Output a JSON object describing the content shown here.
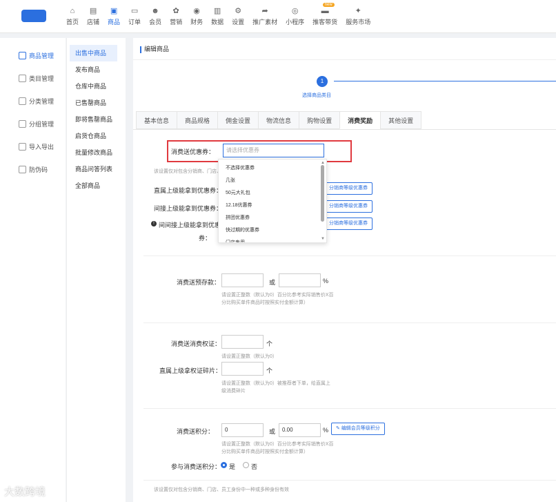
{
  "topnav": [
    {
      "label": "首页",
      "icon": "home-icon"
    },
    {
      "label": "店铺",
      "icon": "store-icon"
    },
    {
      "label": "商品",
      "icon": "product-icon"
    },
    {
      "label": "订单",
      "icon": "order-icon"
    },
    {
      "label": "会员",
      "icon": "member-icon"
    },
    {
      "label": "营销",
      "icon": "marketing-icon"
    },
    {
      "label": "财务",
      "icon": "finance-icon"
    },
    {
      "label": "数据",
      "icon": "chart-icon"
    },
    {
      "label": "设置",
      "icon": "gear-icon"
    },
    {
      "label": "推广素材",
      "icon": "share-icon"
    },
    {
      "label": "小程序",
      "icon": "miniapp-icon"
    },
    {
      "label": "推客带货",
      "icon": "promoter-icon",
      "badge": "new"
    },
    {
      "label": "服务市场",
      "icon": "market-icon"
    }
  ],
  "leftnav": [
    "商品管理",
    "类目管理",
    "分类管理",
    "分组管理",
    "导入导出",
    "防伪码"
  ],
  "subnav": [
    "出售中商品",
    "发布商品",
    "仓库中商品",
    "已售罄商品",
    "即将售罄商品",
    "启货仓商品",
    "批量修改商品",
    "商品问答列表",
    "全部商品"
  ],
  "page_title": "编辑商品",
  "step": {
    "number": "1",
    "label": "选择商品类目"
  },
  "tabs": [
    "基本信息",
    "商品规格",
    "佣金设置",
    "物流信息",
    "购物设置",
    "消费奖励",
    "其他设置"
  ],
  "form": {
    "coupon_label": "消费送优惠券：",
    "coupon_placeholder": "请选择优惠券",
    "coupon_hint": "该设置仅对包含分销商、门店、",
    "direct_coupon_label": "直属上级能拿到优惠券：",
    "indirect_coupon_label": "间接上级能拿到优惠券：",
    "indirect2_coupon_label1": "间间接上级能拿到优惠",
    "indirect2_coupon_label2": "券：",
    "edit_dist_coupon_btn": "分销商等级优惠券",
    "dropdown_options": [
      "不选择优惠券",
      "几张",
      "50元大礼包",
      "12.18优惠券",
      "拼团优惠券",
      "快过期的优惠券",
      "门店专用"
    ],
    "prestore_label": "消费送预存款：",
    "or_text": "或",
    "percent": "%",
    "prestore_hint1": "请设置正整数（默认为0）百分比参考实际销售价X百",
    "prestore_hint2": "分比购买单件商品时按照实付金额计算）",
    "voucher_label": "消费送消费权证：",
    "unit_ge": "个",
    "voucher_hint": "请设置正整数（默认为0）",
    "direct_voucher_label": "直属上级拿权证碎片：",
    "direct_voucher_hint1": "请设置正整数（默认为0）被推荐者下单，给直属上",
    "direct_voucher_hint2": "级消费碎片",
    "points_label": "消费送积分：",
    "points_value": "0",
    "points_pct_value": "0.00",
    "edit_member_points_btn": "编辑会员等级积分",
    "points_hint1": "请设置正整数（默认为0）百分比参考实际销售价X百",
    "points_hint2": "分比购买单件商品时按照实付金额计算）",
    "join_points_label": "参与消费送积分：",
    "yes": "是",
    "no": "否",
    "bottom_hint": "该设置仅对包含分销商、门店、员工身份中一种或多种身份有效"
  },
  "watermark": "大数跨境"
}
